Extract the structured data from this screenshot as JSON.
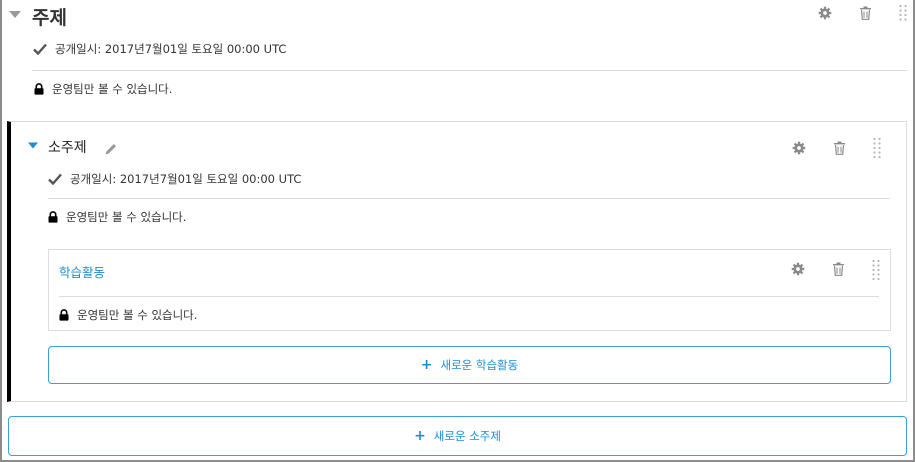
{
  "section": {
    "title": "주제",
    "release": "공개일시: 2017년7월01일 토요일 00:00 UTC",
    "visibility": "운영팀만 볼 수 있습니다."
  },
  "subsection": {
    "title": "소주제",
    "release": "공개일시: 2017년7월01일 토요일 00:00 UTC",
    "visibility": "운영팀만 볼 수 있습니다."
  },
  "unit": {
    "title": "학습활동",
    "visibility": "운영팀만 볼 수 있습니다."
  },
  "buttons": {
    "new_unit": "새로운 학습활동",
    "new_subsection": "새로운 소주제"
  },
  "colors": {
    "accent": "#1d8dd1",
    "subsection_bar": "#000000",
    "icon_gray": "#8a8a8a"
  }
}
